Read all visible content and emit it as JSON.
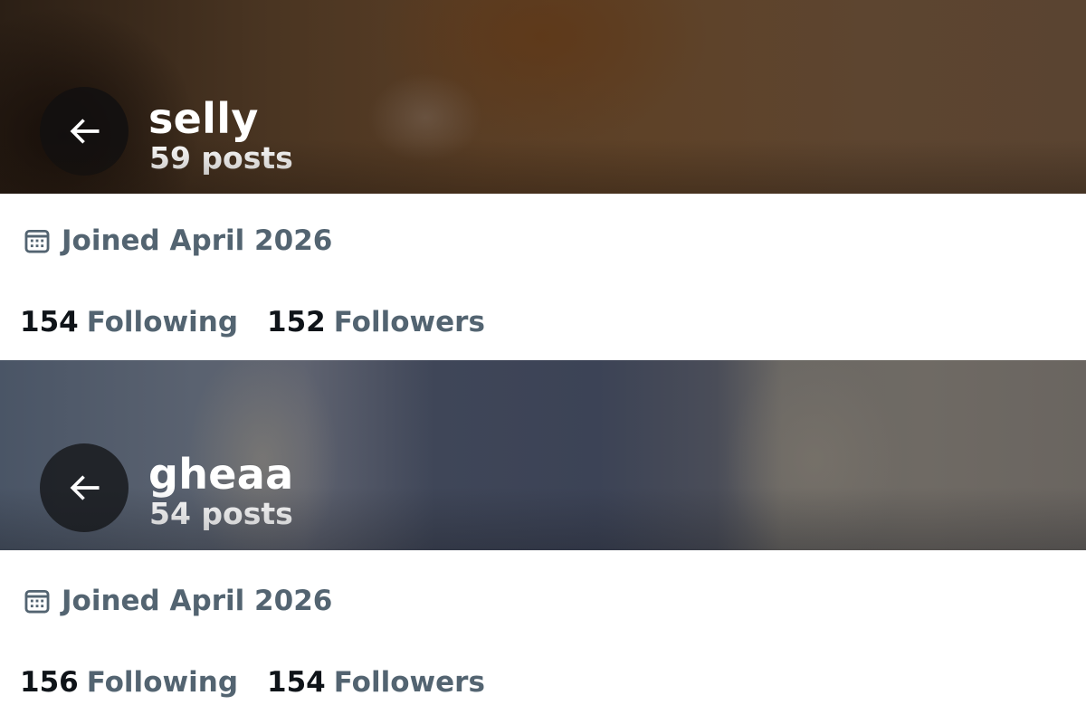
{
  "profiles": [
    {
      "name": "selly",
      "posts": "59 posts",
      "joined": "Joined April 2026",
      "following_count": "154",
      "following_label": "Following",
      "followers_count": "152",
      "followers_label": "Followers"
    },
    {
      "name": "gheaa",
      "posts": "54 posts",
      "joined": "Joined April 2026",
      "following_count": "156",
      "following_label": "Following",
      "followers_count": "154",
      "followers_label": "Followers"
    }
  ],
  "icons": {
    "back": "arrow-left-icon",
    "joined": "calendar-icon"
  },
  "colors": {
    "text_primary": "#0f1419",
    "text_secondary": "#536471",
    "header_text": "#ffffff",
    "back_button_bg": "#121010"
  }
}
